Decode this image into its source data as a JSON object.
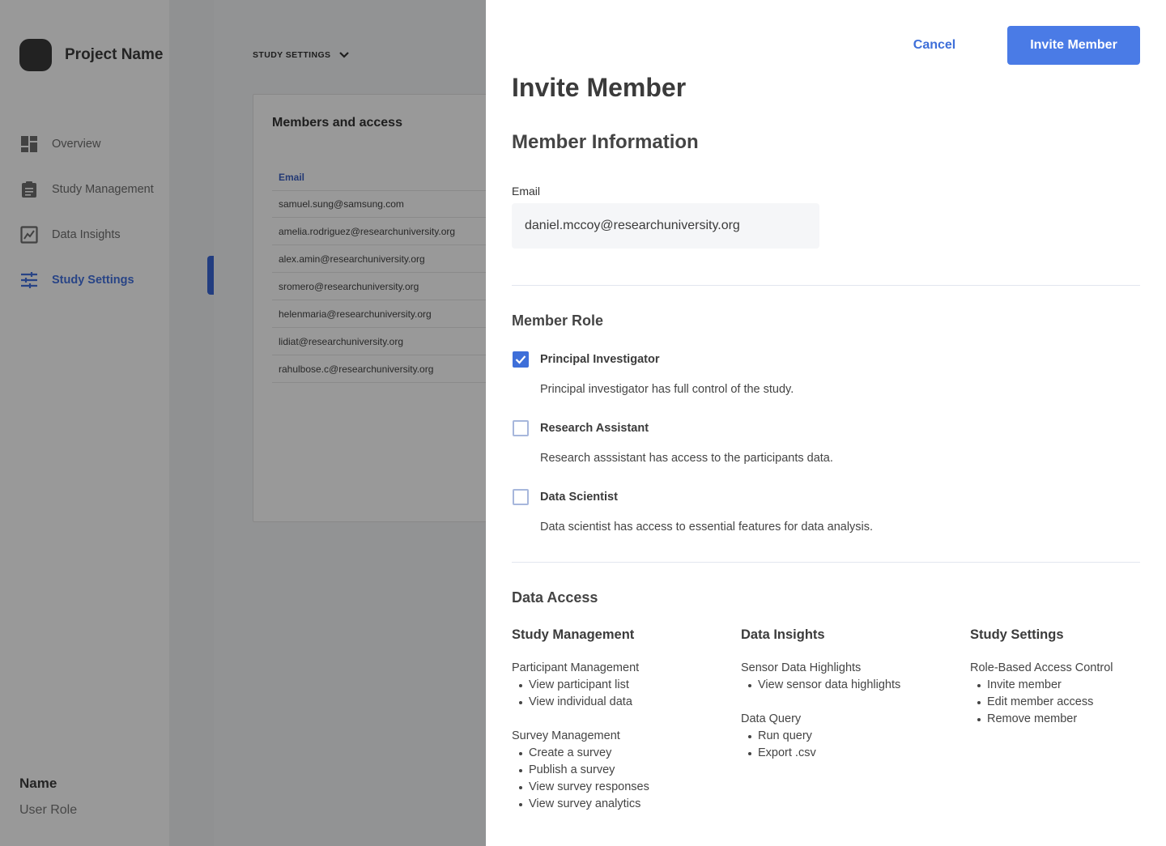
{
  "sidebar": {
    "project_name": "Project Name",
    "nav": [
      {
        "label": "Overview",
        "icon": "dashboard-icon",
        "active": false
      },
      {
        "label": "Study Management",
        "icon": "clipboard-icon",
        "active": false
      },
      {
        "label": "Data Insights",
        "icon": "chart-icon",
        "active": false
      },
      {
        "label": "Study Settings",
        "icon": "sliders-icon",
        "active": true
      }
    ],
    "user": {
      "name": "Name",
      "role": "User Role"
    }
  },
  "background": {
    "breadcrumb": "STUDY SETTINGS",
    "card_title": "Members and access",
    "column_header": "Email",
    "emails": [
      "samuel.sung@samsung.com",
      "amelia.rodriguez@researchuniversity.org",
      "alex.amin@researchuniversity.org",
      "sromero@researchuniversity.org",
      "helenmaria@researchuniversity.org",
      "lidiat@researchuniversity.org",
      "rahulbose.c@researchuniversity.org"
    ]
  },
  "drawer": {
    "cancel_label": "Cancel",
    "invite_label": "Invite Member",
    "title": "Invite Member",
    "member_info": {
      "heading": "Member Information",
      "email_label": "Email",
      "email_value": "daniel.mccoy@researchuniversity.org"
    },
    "member_role": {
      "heading": "Member Role",
      "roles": [
        {
          "label": "Principal Investigator",
          "description": "Principal investigator has full control of the study.",
          "checked": true
        },
        {
          "label": "Research Assistant",
          "description": "Research asssistant has access to the participants data.",
          "checked": false
        },
        {
          "label": "Data Scientist",
          "description": "Data scientist has access to essential features for data analysis.",
          "checked": false
        }
      ]
    },
    "data_access": {
      "heading": "Data Access",
      "columns": [
        {
          "title": "Study Management",
          "groups": [
            {
              "title": "Participant Management",
              "items": [
                "View participant list",
                "View individual data"
              ]
            },
            {
              "title": "Survey Management",
              "items": [
                "Create a survey",
                "Publish a survey",
                "View survey responses",
                "View survey analytics"
              ]
            }
          ]
        },
        {
          "title": "Data Insights",
          "groups": [
            {
              "title": "Sensor Data Highlights",
              "items": [
                "View sensor data highlights"
              ]
            },
            {
              "title": "Data Query",
              "items": [
                "Run query",
                "Export .csv"
              ]
            }
          ]
        },
        {
          "title": "Study Settings",
          "groups": [
            {
              "title": "Role-Based Access Control",
              "items": [
                "Invite member",
                "Edit member access",
                "Remove member"
              ]
            }
          ]
        }
      ]
    }
  },
  "colors": {
    "accent": "#4a7be6",
    "overlay": "rgba(0,0,0,0.4)"
  }
}
